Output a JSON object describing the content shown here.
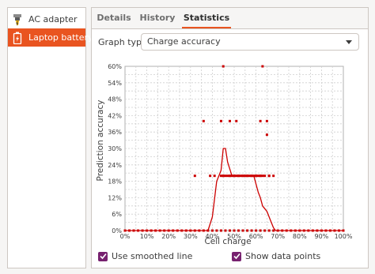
{
  "sidebar": {
    "items": [
      {
        "label": "AC adapter",
        "icon": "ac-adapter-icon",
        "selected": false
      },
      {
        "label": "Laptop battery",
        "icon": "battery-icon",
        "selected": true
      }
    ]
  },
  "tabs": [
    {
      "label": "Details"
    },
    {
      "label": "History"
    },
    {
      "label": "Statistics"
    }
  ],
  "active_tab": "Statistics",
  "graph_type": {
    "label": "Graph type:",
    "selected": "Charge accuracy"
  },
  "options": {
    "smoothed_line": {
      "label": "Use smoothed line",
      "checked": true
    },
    "data_points": {
      "label": "Show data points",
      "checked": true
    }
  },
  "colors": {
    "accent": "#e95420",
    "check": "#77216f",
    "series": "#cc0000"
  },
  "chart_data": {
    "type": "line",
    "xlabel": "Cell charge",
    "ylabel": "Prediction accuracy",
    "xlim": [
      0,
      100
    ],
    "ylim": [
      0,
      60
    ],
    "x_ticks": [
      "0%",
      "10%",
      "20%",
      "30%",
      "40%",
      "50%",
      "60%",
      "70%",
      "80%",
      "90%",
      "100%"
    ],
    "y_ticks": [
      "0%",
      "6%",
      "12%",
      "18%",
      "24%",
      "30%",
      "36%",
      "42%",
      "48%",
      "54%",
      "60%"
    ],
    "grid": true,
    "series": [
      {
        "kind": "smoothed-line",
        "x": [
          0,
          10,
          20,
          30,
          38,
          40,
          42,
          44,
          45,
          46,
          47,
          49,
          51,
          53,
          55,
          57,
          59,
          61,
          62,
          63,
          65,
          67,
          68,
          69,
          70,
          80,
          100
        ],
        "y": [
          0,
          0,
          0,
          0,
          0,
          5,
          18,
          22,
          30,
          30,
          25,
          20,
          20,
          20,
          20,
          20,
          20,
          14,
          12,
          9,
          7,
          3,
          1,
          0,
          0,
          0,
          0
        ]
      },
      {
        "kind": "points",
        "x": [
          0,
          2,
          4,
          6,
          8,
          10,
          12,
          14,
          16,
          18,
          20,
          22,
          24,
          26,
          28,
          30,
          32,
          34,
          36,
          38,
          40,
          42,
          44,
          46,
          48,
          50,
          52,
          54,
          56,
          58,
          60,
          62,
          64,
          66,
          68,
          70,
          72,
          74,
          76,
          78,
          80,
          82,
          84,
          86,
          88,
          90,
          92,
          94,
          96,
          98,
          100,
          32,
          36,
          39,
          41,
          45,
          48,
          50,
          52,
          54,
          56,
          58,
          60,
          62,
          66,
          44,
          45,
          46,
          47,
          48,
          49,
          50,
          51,
          52,
          53,
          54,
          55,
          56,
          57,
          58,
          59,
          60,
          61,
          62,
          63,
          64,
          66,
          68,
          44,
          48,
          51,
          62,
          65,
          65,
          45,
          63
        ],
        "y": [
          0,
          0,
          0,
          0,
          0,
          0,
          0,
          0,
          0,
          0,
          0,
          0,
          0,
          0,
          0,
          0,
          0,
          0,
          0,
          0,
          0,
          0,
          0,
          0,
          0,
          0,
          0,
          0,
          0,
          0,
          0,
          0,
          0,
          0,
          0,
          0,
          0,
          0,
          0,
          0,
          0,
          0,
          0,
          0,
          0,
          0,
          0,
          0,
          0,
          0,
          0,
          20,
          40,
          20,
          20,
          20,
          20,
          20,
          20,
          20,
          20,
          20,
          20,
          20,
          20,
          20,
          20,
          20,
          20,
          20,
          20,
          20,
          20,
          20,
          20,
          20,
          20,
          20,
          20,
          20,
          20,
          20,
          20,
          20,
          20,
          20,
          20,
          20,
          40,
          40,
          40,
          40,
          40,
          35,
          60,
          60
        ]
      }
    ]
  }
}
